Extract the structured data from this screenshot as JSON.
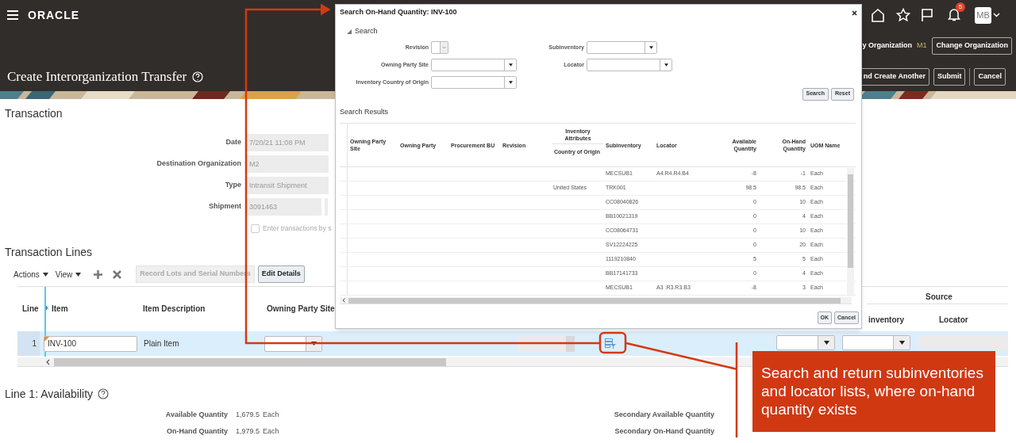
{
  "header": {
    "logo": "ORACLE",
    "notification_count": "5",
    "avatar": "MB",
    "organization_label": "y Organization",
    "organization": "M1",
    "change_button": "Change Organization",
    "title": "Create Interorganization Transfer",
    "buttons": [
      "nd Create Another",
      "Submit",
      "Cancel"
    ]
  },
  "transaction": {
    "heading": "Transaction",
    "fields": [
      {
        "label": "Date",
        "value": "7/20/21 11:08 PM"
      },
      {
        "label": "Destination Organization",
        "value": "M2"
      },
      {
        "label": "Type",
        "value": "Intransit Shipment"
      },
      {
        "label": "Shipment",
        "value": "3091463",
        "kind": "split"
      }
    ],
    "checkbox": {
      "label": "Enter transactions by s",
      "checked": false
    }
  },
  "transaction_lines": {
    "heading": "Transaction Lines",
    "menus": [
      "Actions",
      "View"
    ],
    "buttons": [
      {
        "label": "Record Lots and Serial Numbers",
        "disabled": true
      },
      {
        "label": "Edit Details",
        "disabled": false
      }
    ],
    "columns": [
      {
        "label": "Line",
        "required": false
      },
      {
        "label": "Item",
        "required": true
      },
      {
        "label": "Item Description",
        "required": false
      },
      {
        "label": "Owning Party Site",
        "required": false
      }
    ],
    "source_group": "Source",
    "right_columns": [
      "inventory",
      "Locator"
    ],
    "rows": [
      {
        "line": "1",
        "item": "INV-100",
        "description": "Plain Item",
        "selected": true
      }
    ]
  },
  "availability": {
    "heading": "Line 1: Availability",
    "quantities": [
      {
        "label": "Available Quantity",
        "value": "1,679.5",
        "uom": "Each"
      },
      {
        "label": "On-Hand Quantity",
        "value": "1,979.5",
        "uom": "Each"
      }
    ],
    "secondary": [
      "Secondary Available Quantity",
      "Secondary On-Hand Quantity"
    ]
  },
  "dialog": {
    "title": "Search On-Hand Quantity: INV-100",
    "search": {
      "heading": "Search",
      "expanded": true,
      "left_fields": [
        {
          "label": "Revision",
          "kind": "small"
        },
        {
          "label": "Owning Party Site",
          "kind": "select"
        },
        {
          "label": "Inventory Country of Origin",
          "kind": "select"
        }
      ],
      "right_fields": [
        {
          "label": "Subinventory",
          "kind": "select"
        },
        {
          "label": "Locator",
          "kind": "wide"
        }
      ],
      "buttons": [
        "Search",
        "Reset"
      ]
    },
    "results": {
      "heading": "Search Results",
      "columns": [
        {
          "label": "Owning Party Site",
          "kind": "text"
        },
        {
          "label": "Owning Party",
          "kind": "text"
        },
        {
          "label": "Procurement BU",
          "kind": "text"
        },
        {
          "label": "Revision",
          "kind": "text"
        },
        {
          "label": "Country of Origin",
          "kind": "group",
          "group": "Inventory Attributes"
        },
        {
          "label": "Subinventory",
          "kind": "text"
        },
        {
          "label": "Locator",
          "kind": "text"
        },
        {
          "label": "Available Quantity",
          "kind": "number"
        },
        {
          "label": "On-Hand Quantity",
          "kind": "number"
        },
        {
          "label": "UOM Name",
          "kind": "text"
        }
      ],
      "rows": [
        [
          null,
          null,
          null,
          null,
          null,
          "MECSUB1",
          "A4.R4.R4.B4",
          "-8",
          "-1",
          "Each"
        ],
        [
          null,
          null,
          null,
          null,
          "United States",
          "TRK001",
          null,
          "98.5",
          "98.5",
          "Each"
        ],
        [
          null,
          null,
          null,
          null,
          null,
          "CC08040826",
          null,
          "0",
          "10",
          "Each"
        ],
        [
          null,
          null,
          null,
          null,
          null,
          "BB10021319",
          null,
          "0",
          "4",
          "Each"
        ],
        [
          null,
          null,
          null,
          null,
          null,
          "CC08064731",
          null,
          "0",
          "10",
          "Each"
        ],
        [
          null,
          null,
          null,
          null,
          null,
          "SV12224225",
          null,
          "0",
          "20",
          "Each"
        ],
        [
          null,
          null,
          null,
          null,
          null,
          "1119210840",
          null,
          "5",
          "5",
          "Each"
        ],
        [
          null,
          null,
          null,
          null,
          null,
          "BB17141733",
          null,
          "0",
          "4",
          "Each"
        ],
        [
          null,
          null,
          null,
          null,
          null,
          "MECSUB1",
          "A3 .R3.R3.B3",
          "-8",
          "3",
          "Each"
        ]
      ]
    },
    "buttons": [
      "OK",
      "Cancel"
    ]
  },
  "callout": "Search and return subinventories and locator lists, where on-hand quantity exists"
}
